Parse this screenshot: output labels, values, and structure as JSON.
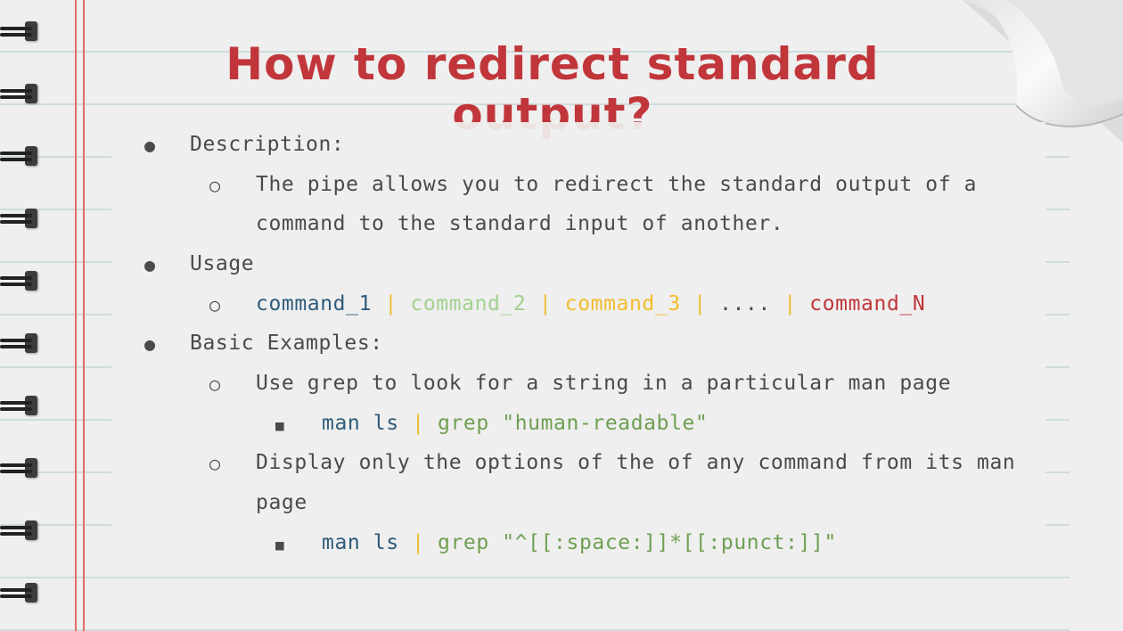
{
  "title": "How to redirect standard output?",
  "sections": [
    {
      "heading": "Description:",
      "sub": [
        {
          "text_line1": "The pipe allows you to redirect the standard output of a",
          "text_line2": "command to the standard input of another."
        }
      ]
    },
    {
      "heading": "Usage",
      "usage": {
        "cmd1": "command_1",
        "sep1": " | ",
        "cmd2": "command_2",
        "sep2": " | ",
        "cmd3": "command_3",
        "sep3": " | ",
        "dots": "....",
        "sep4": " | ",
        "cmdN": "command_N"
      }
    },
    {
      "heading": "Basic Examples:",
      "examples": [
        {
          "desc": "Use grep to look for a string in a particular man page",
          "code_cmd": "man ls",
          "code_pipe": " | ",
          "code_grep": "grep \"human-readable\""
        },
        {
          "desc_line1": "Display only the options of the of any command from its man",
          "desc_line2": "page",
          "code_cmd": "man ls",
          "code_pipe": " | ",
          "code_grep": "grep \"^[[:space:]]*[[:punct:]]\""
        }
      ]
    }
  ],
  "colors": {
    "title": "#c1363a",
    "command_1": "#2e5b7a",
    "command_2": "#a3d18f",
    "command_3": "#f1bd2c",
    "command_N": "#c1363a",
    "grep": "#6f9f52"
  },
  "icons": {
    "level1_bullet": "filled-circle",
    "level2_bullet": "hollow-circle",
    "level3_bullet": "filled-square"
  }
}
